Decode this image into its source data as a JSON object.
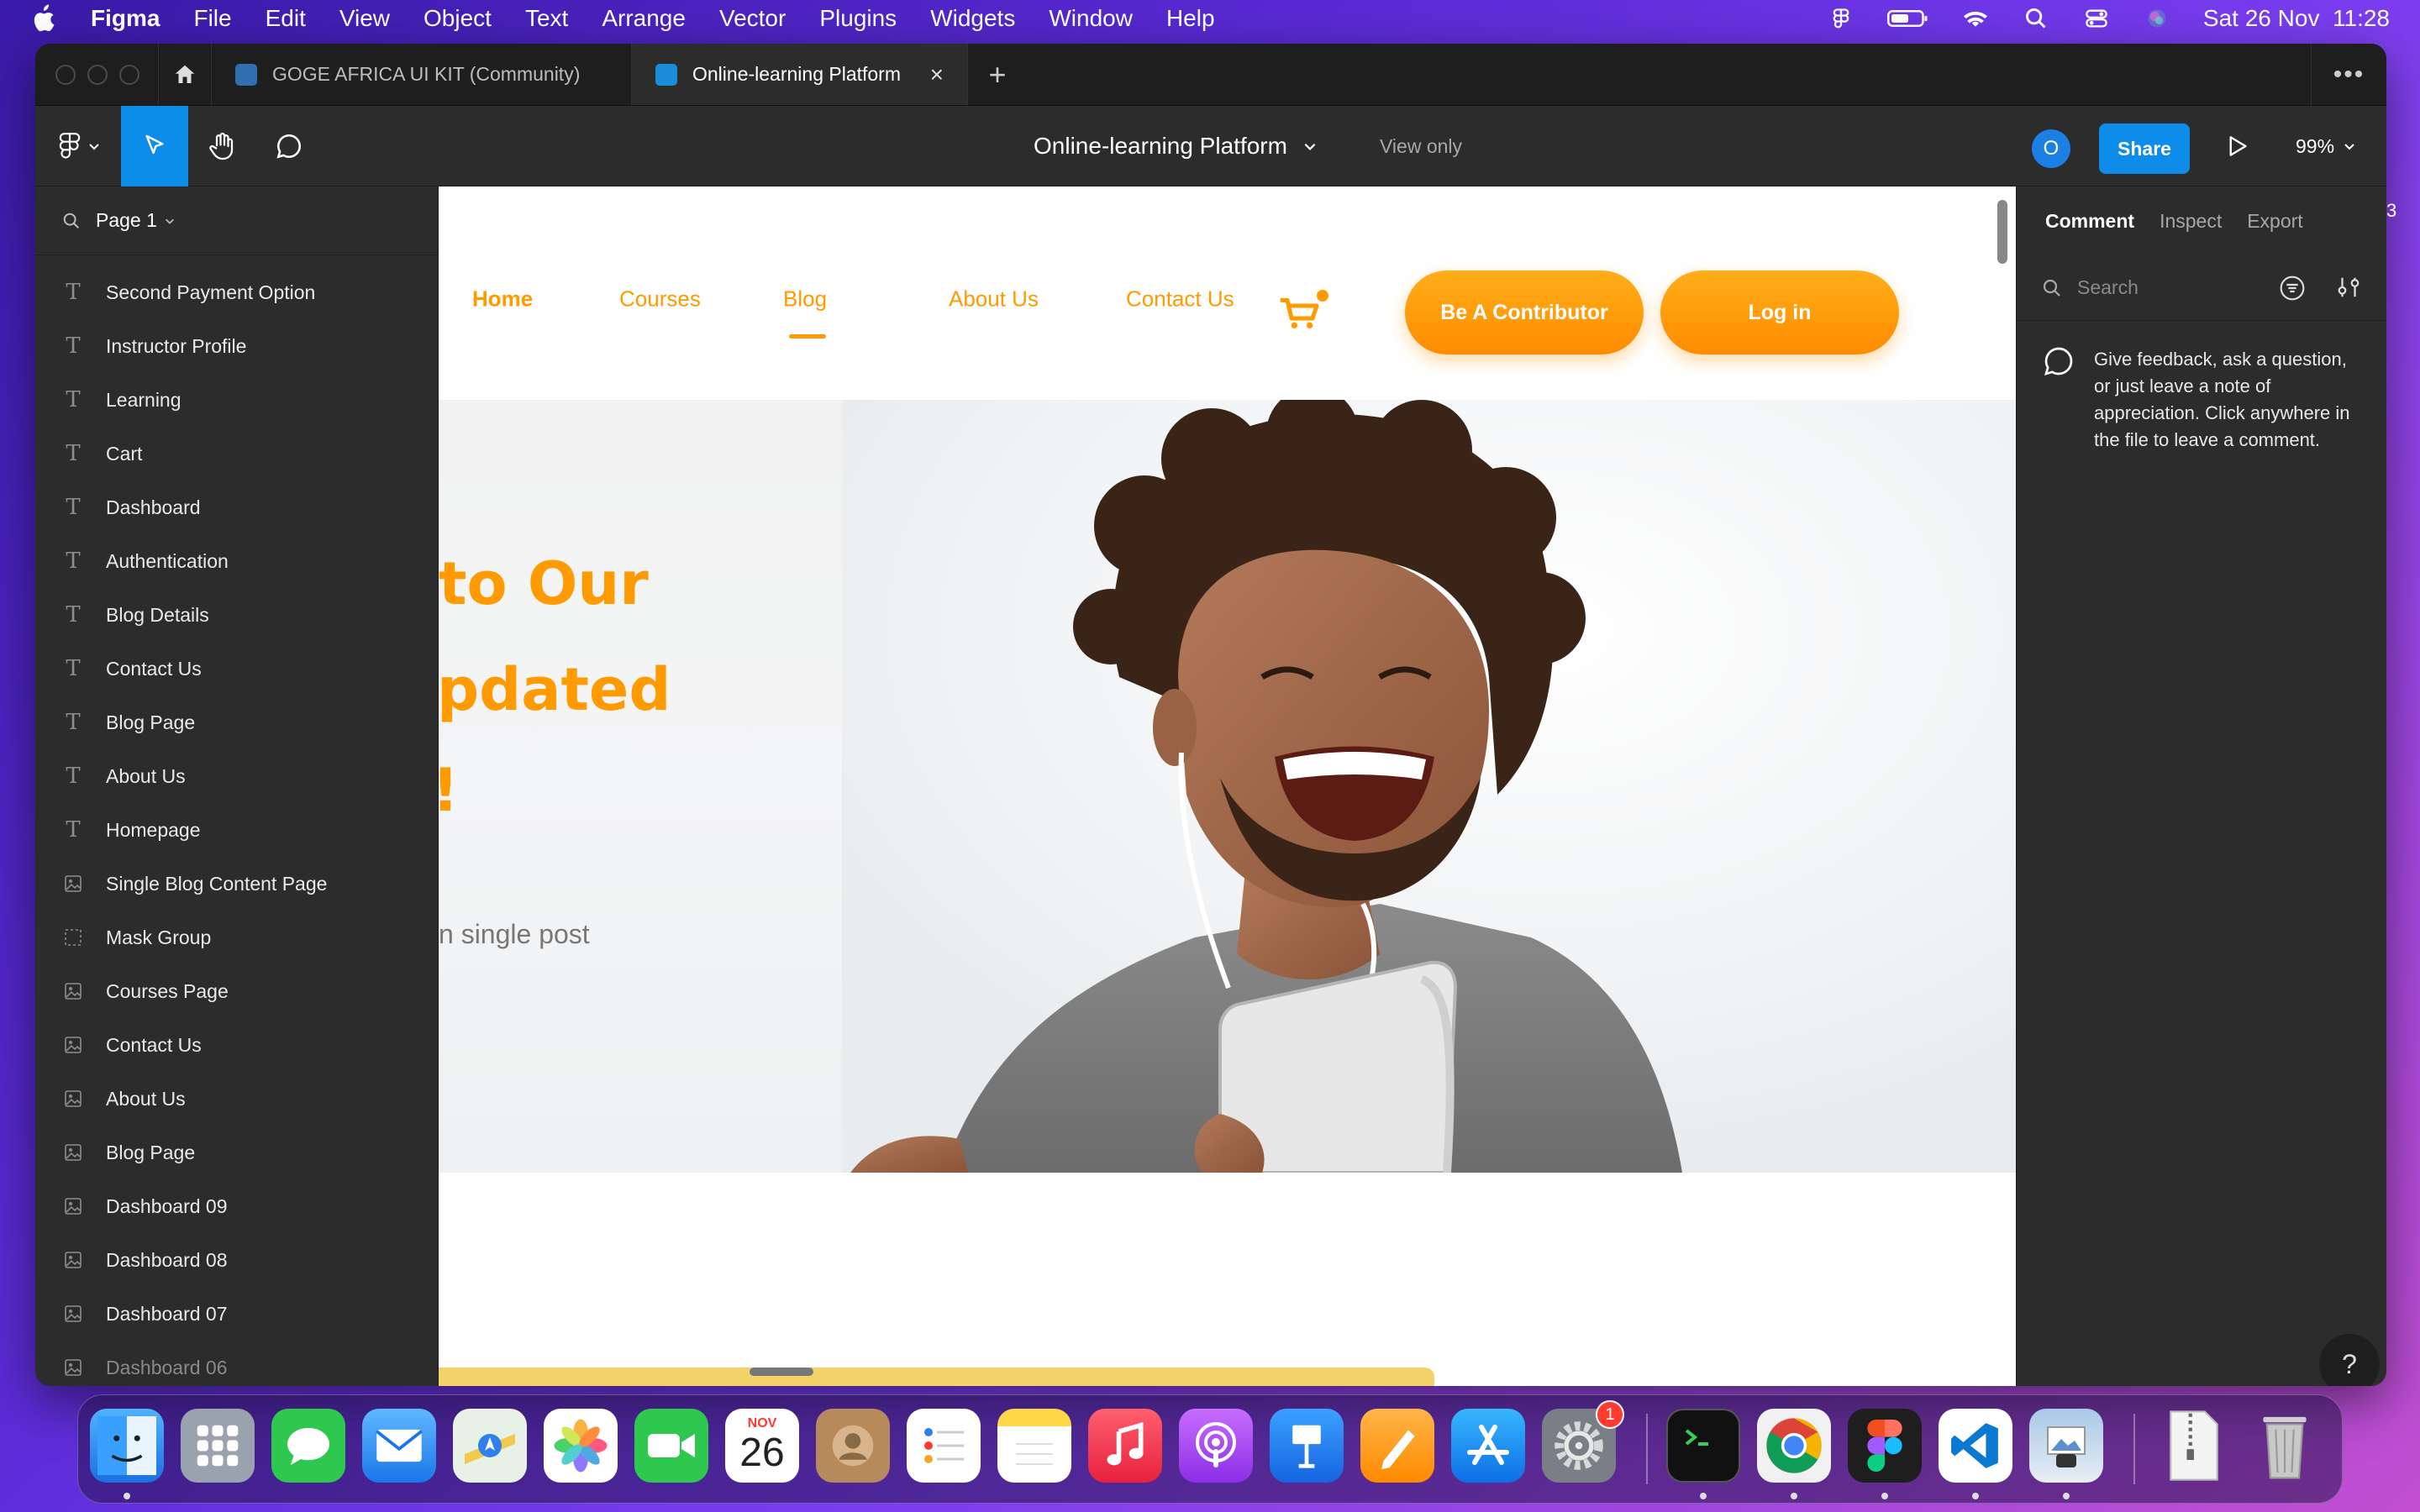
{
  "menubar": {
    "app_name": "Figma",
    "items": [
      "File",
      "Edit",
      "View",
      "Object",
      "Text",
      "Arrange",
      "Vector",
      "Plugins",
      "Widgets",
      "Window",
      "Help"
    ],
    "clock": "Sat 26 Nov  11:28"
  },
  "tabs": [
    {
      "label": "GOGE AFRICA UI KIT (Community)"
    },
    {
      "label": "Online-learning Platform"
    }
  ],
  "toolbar": {
    "file_title": "Online-learning Platform",
    "view_mode": "View only",
    "avatar_initial": "O",
    "share_label": "Share",
    "zoom": "99%"
  },
  "layers": {
    "page": "Page 1",
    "items": [
      {
        "type": "text",
        "label": "Second Payment Option"
      },
      {
        "type": "text",
        "label": "Instructor Profile"
      },
      {
        "type": "text",
        "label": "Learning"
      },
      {
        "type": "text",
        "label": "Cart"
      },
      {
        "type": "text",
        "label": "Dashboard"
      },
      {
        "type": "text",
        "label": "Authentication"
      },
      {
        "type": "text",
        "label": "Blog Details"
      },
      {
        "type": "text",
        "label": "Contact Us"
      },
      {
        "type": "text",
        "label": "Blog Page"
      },
      {
        "type": "text",
        "label": "About Us"
      },
      {
        "type": "text",
        "label": "Homepage"
      },
      {
        "type": "image",
        "label": "Single Blog Content Page"
      },
      {
        "type": "mask",
        "label": "Mask Group"
      },
      {
        "type": "image",
        "label": "Courses Page"
      },
      {
        "type": "image",
        "label": "Contact Us"
      },
      {
        "type": "image",
        "label": "About Us"
      },
      {
        "type": "image",
        "label": "Blog Page"
      },
      {
        "type": "image",
        "label": "Dashboard 09"
      },
      {
        "type": "image",
        "label": "Dashboard 08"
      },
      {
        "type": "image",
        "label": "Dashboard 07"
      },
      {
        "type": "image",
        "label": "Dashboard 06"
      }
    ]
  },
  "canvas": {
    "nav": {
      "home": "Home",
      "courses": "Courses",
      "blog": "Blog",
      "about": "About Us",
      "contact": "Contact Us",
      "contributor_btn": "Be A Contributor",
      "login_btn": "Log in"
    },
    "hero": {
      "line1": "to Our",
      "line2": "pdated",
      "line3": "!",
      "subtitle": "n single post"
    },
    "accent": "#ff9a00"
  },
  "right_panel": {
    "tabs": [
      "Comment",
      "Inspect",
      "Export"
    ],
    "search_placeholder": "Search",
    "hint": "Give feedback, ask a question, or just leave a note of appreciation. Click anywhere in the file to leave a comment.",
    "help": "?",
    "edge_number": "3"
  },
  "dock": {
    "calendar_month": "NOV",
    "calendar_day": "26",
    "settings_badge": "1"
  }
}
